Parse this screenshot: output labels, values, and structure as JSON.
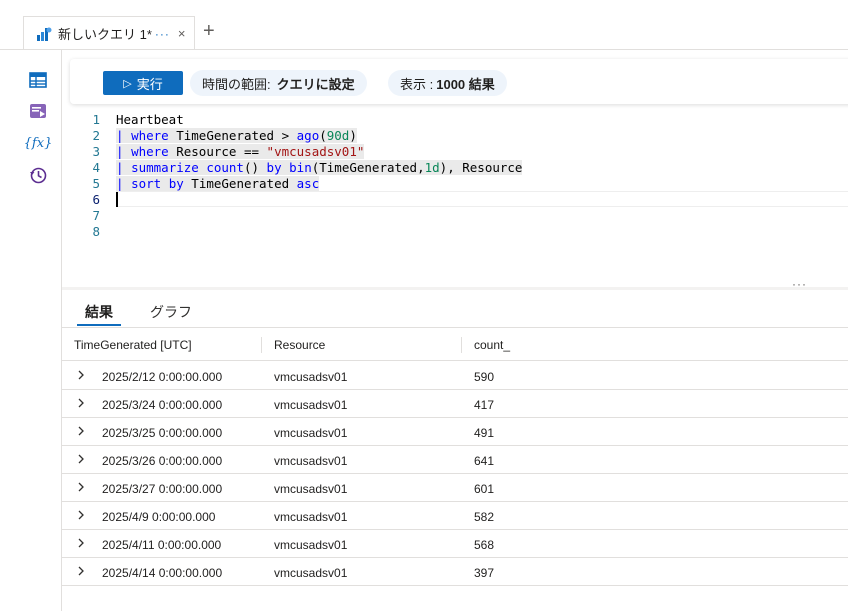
{
  "tab": {
    "title": "新しいクエリ 1*",
    "more": "···",
    "close": "×",
    "add": "+"
  },
  "rail": {
    "icons": [
      "tables-icon",
      "queries-icon",
      "functions-icon",
      "history-icon"
    ],
    "functions_label": "{fx}"
  },
  "toolbar": {
    "run_label": "実行",
    "time_range_label": "時間の範囲:",
    "time_range_value": "クエリに設定",
    "limit_label": "表示 :",
    "limit_value": "1000 結果"
  },
  "editor": {
    "line_numbers": [
      "1",
      "2",
      "3",
      "4",
      "5",
      "6",
      "7",
      "8"
    ],
    "lines": [
      "Heartbeat",
      "| where TimeGenerated > ago(90d)",
      "| where Resource == \"vmcusadsv01\"",
      "| summarize count() by bin(TimeGenerated,1d), Resource",
      "| sort by TimeGenerated asc",
      "",
      "",
      ""
    ],
    "split_menu": "···"
  },
  "results": {
    "tabs": [
      "結果",
      "グラフ"
    ],
    "columns": [
      "TimeGenerated [UTC]",
      "Resource",
      "count_"
    ],
    "rows": [
      [
        "2025/2/12 0:00:00.000",
        "vmcusadsv01",
        "590"
      ],
      [
        "2025/3/24 0:00:00.000",
        "vmcusadsv01",
        "417"
      ],
      [
        "2025/3/25 0:00:00.000",
        "vmcusadsv01",
        "491"
      ],
      [
        "2025/3/26 0:00:00.000",
        "vmcusadsv01",
        "641"
      ],
      [
        "2025/3/27 0:00:00.000",
        "vmcusadsv01",
        "601"
      ],
      [
        "2025/4/9 0:00:00.000",
        "vmcusadsv01",
        "582"
      ],
      [
        "2025/4/11 0:00:00.000",
        "vmcusadsv01",
        "568"
      ],
      [
        "2025/4/14 0:00:00.000",
        "vmcusadsv01",
        "397"
      ]
    ]
  },
  "colors": {
    "accent": "#0f6cbd",
    "pill": "#eef4fb",
    "keyword": "#0000ff",
    "string": "#a31515",
    "number": "#098658"
  }
}
